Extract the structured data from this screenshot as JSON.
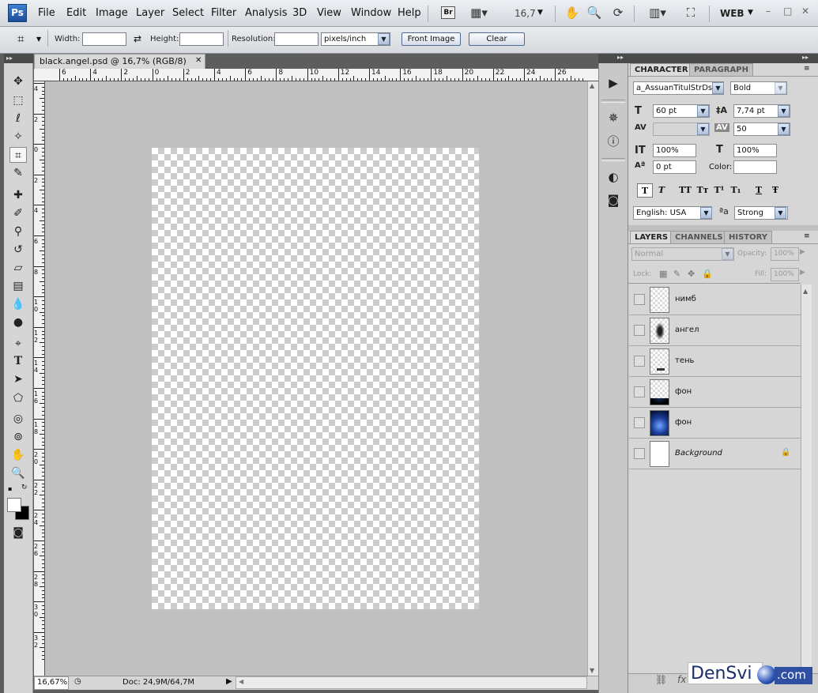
{
  "menubar": {
    "logo": "Ps",
    "items": [
      "File",
      "Edit",
      "Image",
      "Layer",
      "Select",
      "Filter",
      "Analysis",
      "3D",
      "View",
      "Window",
      "Help"
    ],
    "bridge": "Br",
    "zoom": "16,7",
    "workspace": "WEB"
  },
  "options": {
    "width_label": "Width:",
    "height_label": "Height:",
    "resolution_label": "Resolution:",
    "resolution_unit": "pixels/inch",
    "front_image_label": "Front Image",
    "clear_label": "Clear"
  },
  "document": {
    "tab_title": "black.angel.psd @ 16,7% (RGB/8)",
    "ruler_top_ticks": [
      "6",
      "4",
      "2",
      "0",
      "2",
      "4",
      "6",
      "8",
      "10",
      "12",
      "14",
      "16",
      "18",
      "20",
      "22",
      "24",
      "26"
    ],
    "ruler_left_ticks": [
      "4",
      "2",
      "0",
      "2",
      "4",
      "6",
      "8",
      "1\n0",
      "1\n2",
      "1\n4",
      "1\n6",
      "1\n8",
      "2\n0",
      "2\n2",
      "2\n4",
      "2\n6",
      "2\n8",
      "3\n0",
      "3\n2"
    ],
    "status_zoom": "16,67%",
    "status_doc": "Doc: 24,9M/64,7M"
  },
  "character": {
    "tab_character": "CHARACTER",
    "tab_paragraph": "PARAGRAPH",
    "font_family": "a_AssuanTitulStrDst",
    "font_style": "Bold",
    "font_size": "60 pt",
    "leading": "7,74 pt",
    "kerning": "",
    "tracking": "50",
    "vertical_scale": "100%",
    "horizontal_scale": "100%",
    "baseline_shift": "0 pt",
    "color_label": "Color:",
    "language": "English: USA",
    "antialias": "Strong",
    "format_buttons": [
      "T",
      "T",
      "TT",
      "Tт",
      "T¹",
      "T₁",
      "T",
      "Ŧ"
    ]
  },
  "layers_panel": {
    "tab_layers": "LAYERS",
    "tab_channels": "CHANNELS",
    "tab_history": "HISTORY",
    "blend_mode": "Normal",
    "opacity_label": "Opacity:",
    "opacity_value": "100%",
    "lock_label": "Lock:",
    "fill_label": "Fill:",
    "fill_value": "100%",
    "layers": [
      {
        "name": "нимб"
      },
      {
        "name": "ангел"
      },
      {
        "name": "тень"
      },
      {
        "name": "фон"
      },
      {
        "name": "фон"
      },
      {
        "name": "Background"
      }
    ]
  },
  "watermark": {
    "text": "DenSvi",
    "suffix": ".com"
  },
  "icons": {
    "toolbar": [
      "move-icon",
      "marquee-icon",
      "lasso-icon",
      "magic-wand-icon",
      "crop-icon",
      "eyedropper-icon",
      "healing-brush-icon",
      "brush-icon",
      "clone-stamp-icon",
      "history-brush-icon",
      "eraser-icon",
      "gradient-icon",
      "blur-icon",
      "dodge-icon",
      "pen-icon",
      "type-icon",
      "path-selection-icon",
      "shape-icon",
      "3d-rotate-icon",
      "3d-orbit-icon",
      "hand-icon",
      "zoom-icon"
    ]
  },
  "colors": {
    "accent": "#2c5fa8",
    "canvas_bg": "#c0c0c0",
    "panel_bg": "#d6d6d6",
    "dark_chrome": "#4a4a4a"
  }
}
